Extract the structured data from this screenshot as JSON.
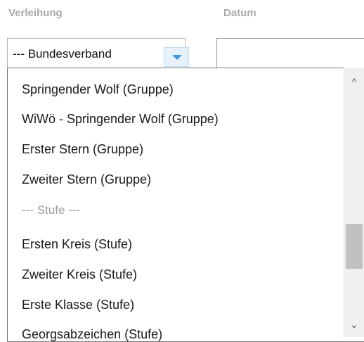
{
  "headers": {
    "verleihung": "Verleihung",
    "datum": "Datum"
  },
  "select": {
    "value": "--- Bundesverband",
    "arrow_icon": "chevron-down-icon",
    "accent": "#3f97e0"
  },
  "date_input": {
    "value": ""
  },
  "dropdown": {
    "options": [
      {
        "label": "Springender Wolf (Gruppe)",
        "group": false
      },
      {
        "label": "WiWö - Springender Wolf (Gruppe)",
        "group": false
      },
      {
        "label": "Erster Stern (Gruppe)",
        "group": false
      },
      {
        "label": "Zweiter Stern (Gruppe)",
        "group": false
      },
      {
        "label": "--- Stufe ---",
        "group": true
      },
      {
        "label": "Ersten Kreis (Stufe)",
        "group": false
      },
      {
        "label": "Zweiter Kreis (Stufe)",
        "group": false
      },
      {
        "label": "Erste Klasse (Stufe)",
        "group": false
      },
      {
        "label": "Georgsabzeichen (Stufe)",
        "group": false
      }
    ]
  },
  "scrollbar": {
    "up_icon": "scroll-up-icon",
    "down_icon": "scroll-down-icon",
    "up_glyph": "^",
    "down_glyph": "⌄",
    "position_fraction": 0.6
  }
}
